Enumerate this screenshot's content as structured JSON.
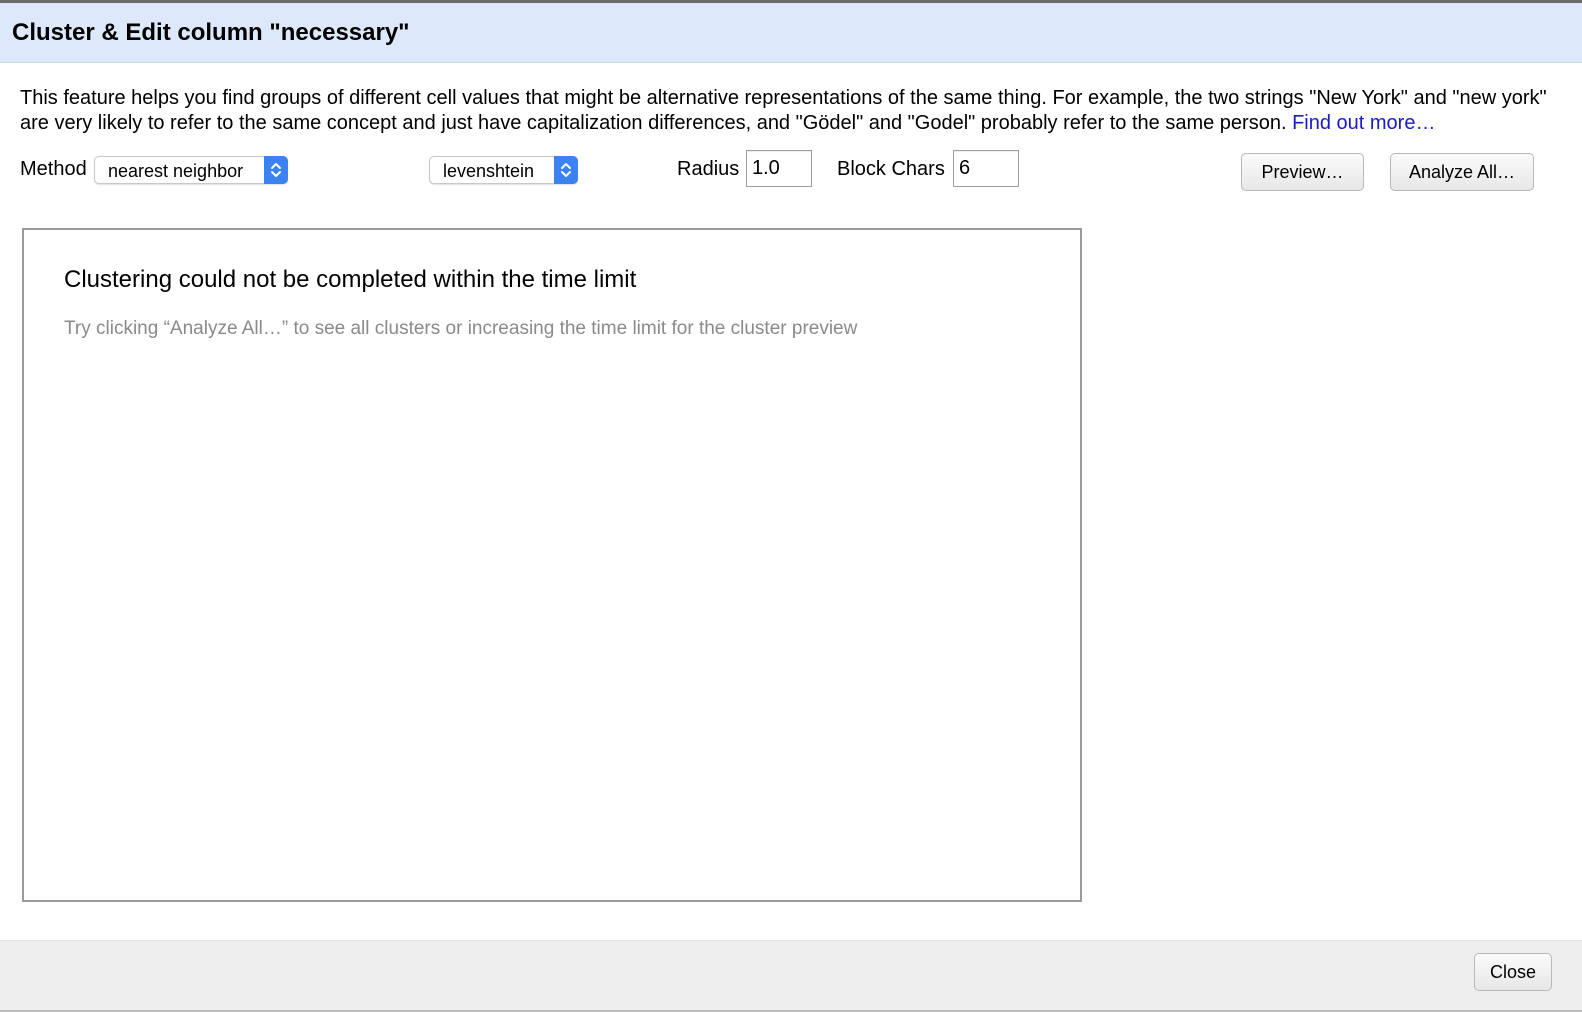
{
  "dialog": {
    "title": "Cluster & Edit column \"necessary\""
  },
  "description": {
    "text": "This feature helps you find groups of different cell values that might be alternative representations of the same thing. For example, the two strings \"New York\" and \"new york\" are very likely to refer to the same concept and just have capitalization differences, and \"Gödel\" and \"Godel\" probably refer to the same person. ",
    "link": "Find out more…"
  },
  "controls": {
    "method_label": "Method",
    "method_value": "nearest neighbor",
    "function_value": "levenshtein",
    "radius_label": "Radius",
    "radius_value": "1.0",
    "block_chars_label": "Block Chars",
    "block_chars_value": "6",
    "preview_button": "Preview…",
    "analyze_all_button": "Analyze All…"
  },
  "results": {
    "message": "Clustering could not be completed within the time limit",
    "hint": "Try clicking “Analyze All…” to see all clusters or increasing the time limit for the cluster preview"
  },
  "footer": {
    "close_button": "Close"
  },
  "colors": {
    "header_bg": "#dde9fb",
    "select_arrow": "#3b83f2",
    "link": "#1a1acd"
  }
}
